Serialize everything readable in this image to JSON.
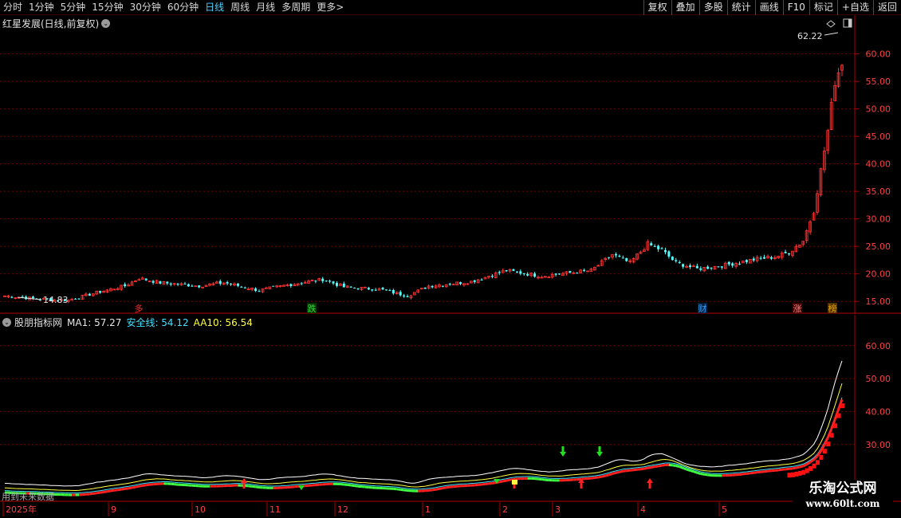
{
  "toolbar": {
    "left_items": [
      "分时",
      "1分钟",
      "5分钟",
      "15分钟",
      "30分钟",
      "60分钟",
      "日线",
      "周线",
      "月线",
      "多周期",
      "更多>"
    ],
    "active_index": 6,
    "right_buttons": [
      "复权",
      "叠加",
      "多股",
      "统计",
      "画线",
      "F10",
      "标记",
      "+自选",
      "返回"
    ]
  },
  "main_chart": {
    "title": "红星发展(日线,前复权)",
    "max_label": "62.22",
    "min_label": "14.83",
    "y_ticks": [
      "60.00",
      "55.00",
      "50.00",
      "45.00",
      "40.00",
      "35.00",
      "30.00",
      "25.00",
      "20.00",
      "15.00"
    ],
    "markers": [
      {
        "text": "多",
        "color": "#ff3030"
      },
      {
        "text": "跌",
        "color": "#30e030"
      },
      {
        "text": "财",
        "color": "#30a0ff"
      },
      {
        "text": "涨",
        "color": "#ff8080"
      },
      {
        "text": "榜",
        "color": "#e0a000"
      }
    ]
  },
  "sub_chart": {
    "name": "股朋指标网",
    "ma1": "MA1: 57.27",
    "safe_line": "安全线: 54.12",
    "aa10": "AA10: 56.54",
    "y_ticks": [
      "60.00",
      "50.00",
      "40.00",
      "30.00"
    ],
    "future_label": "用到未来数据"
  },
  "time_axis": {
    "labels": [
      "2025年",
      "9",
      "10",
      "11",
      "12",
      "1",
      "2",
      "3",
      "4",
      "5"
    ]
  },
  "watermark": {
    "line1": "乐淘公式网",
    "line2": "www.60lt.com"
  },
  "colors": {
    "up": "#ff3232",
    "down": "#54ffff",
    "grid": "#7a0000",
    "axis_text": "#ff4040"
  },
  "chart_data": {
    "type": "candlestick",
    "price_range": [
      13,
      64
    ],
    "highest": 62.22,
    "lowest": 14.83,
    "indicator_values": {
      "MA1": 57.27,
      "安全线": 54.12,
      "AA10": 56.54
    }
  }
}
